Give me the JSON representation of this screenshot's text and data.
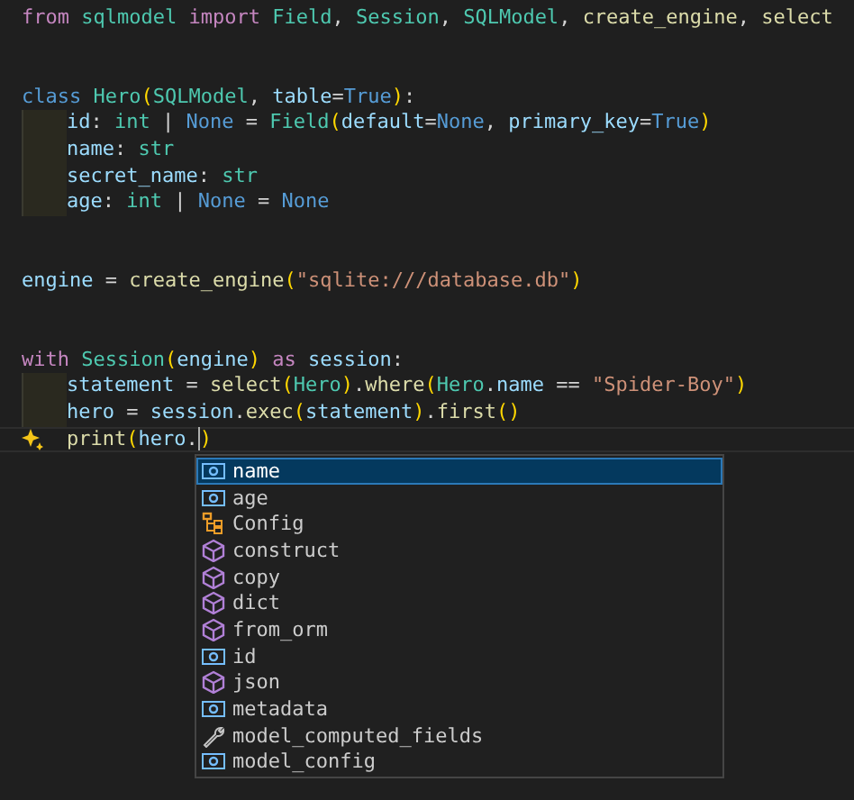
{
  "editor": {
    "lines": [
      {
        "kind": "code",
        "tokens": [
          {
            "kind": "kw",
            "text": "from "
          },
          {
            "kind": "type",
            "text": "sqlmodel "
          },
          {
            "kind": "kw",
            "text": "import "
          },
          {
            "kind": "type",
            "text": "Field"
          },
          {
            "kind": "plain",
            "text": ", "
          },
          {
            "kind": "type",
            "text": "Session"
          },
          {
            "kind": "plain",
            "text": ", "
          },
          {
            "kind": "type",
            "text": "SQLModel"
          },
          {
            "kind": "plain",
            "text": ", "
          },
          {
            "kind": "func",
            "text": "create_engine"
          },
          {
            "kind": "plain",
            "text": ", "
          },
          {
            "kind": "func",
            "text": "select"
          }
        ]
      },
      {
        "kind": "blank"
      },
      {
        "kind": "blank"
      },
      {
        "kind": "code",
        "tokens": [
          {
            "kind": "storage",
            "text": "class "
          },
          {
            "kind": "type",
            "text": "Hero"
          },
          {
            "kind": "bracket",
            "text": "("
          },
          {
            "kind": "type",
            "text": "SQLModel"
          },
          {
            "kind": "plain",
            "text": ", "
          },
          {
            "kind": "var",
            "text": "table"
          },
          {
            "kind": "plain",
            "text": "="
          },
          {
            "kind": "const",
            "text": "True"
          },
          {
            "kind": "bracket",
            "text": ")"
          },
          {
            "kind": "plain",
            "text": ":"
          }
        ]
      },
      {
        "kind": "code",
        "indented": true,
        "tokens": [
          {
            "kind": "var",
            "text": "id"
          },
          {
            "kind": "plain",
            "text": ": "
          },
          {
            "kind": "type",
            "text": "int"
          },
          {
            "kind": "plain",
            "text": " | "
          },
          {
            "kind": "const",
            "text": "None"
          },
          {
            "kind": "plain",
            "text": " = "
          },
          {
            "kind": "type",
            "text": "Field"
          },
          {
            "kind": "bracket",
            "text": "("
          },
          {
            "kind": "var",
            "text": "default"
          },
          {
            "kind": "plain",
            "text": "="
          },
          {
            "kind": "const",
            "text": "None"
          },
          {
            "kind": "plain",
            "text": ", "
          },
          {
            "kind": "var",
            "text": "primary_key"
          },
          {
            "kind": "plain",
            "text": "="
          },
          {
            "kind": "const",
            "text": "True"
          },
          {
            "kind": "bracket",
            "text": ")"
          }
        ]
      },
      {
        "kind": "code",
        "indented": true,
        "tokens": [
          {
            "kind": "var",
            "text": "name"
          },
          {
            "kind": "plain",
            "text": ": "
          },
          {
            "kind": "type",
            "text": "str"
          }
        ]
      },
      {
        "kind": "code",
        "indented": true,
        "tokens": [
          {
            "kind": "var",
            "text": "secret_name"
          },
          {
            "kind": "plain",
            "text": ": "
          },
          {
            "kind": "type",
            "text": "str"
          }
        ]
      },
      {
        "kind": "code",
        "indented": true,
        "tokens": [
          {
            "kind": "var",
            "text": "age"
          },
          {
            "kind": "plain",
            "text": ": "
          },
          {
            "kind": "type",
            "text": "int"
          },
          {
            "kind": "plain",
            "text": " | "
          },
          {
            "kind": "const",
            "text": "None"
          },
          {
            "kind": "plain",
            "text": " = "
          },
          {
            "kind": "const",
            "text": "None"
          }
        ]
      },
      {
        "kind": "blank"
      },
      {
        "kind": "blank"
      },
      {
        "kind": "code",
        "tokens": [
          {
            "kind": "var",
            "text": "engine"
          },
          {
            "kind": "plain",
            "text": " = "
          },
          {
            "kind": "func",
            "text": "create_engine"
          },
          {
            "kind": "bracket",
            "text": "("
          },
          {
            "kind": "str",
            "text": "\"sqlite:///database.db\""
          },
          {
            "kind": "bracket",
            "text": ")"
          }
        ]
      },
      {
        "kind": "blank"
      },
      {
        "kind": "blank"
      },
      {
        "kind": "code",
        "tokens": [
          {
            "kind": "kw",
            "text": "with "
          },
          {
            "kind": "type",
            "text": "Session"
          },
          {
            "kind": "bracket",
            "text": "("
          },
          {
            "kind": "var",
            "text": "engine"
          },
          {
            "kind": "bracket",
            "text": ")"
          },
          {
            "kind": "kw",
            "text": " as "
          },
          {
            "kind": "var",
            "text": "session"
          },
          {
            "kind": "plain",
            "text": ":"
          }
        ]
      },
      {
        "kind": "code",
        "indented": true,
        "tokens": [
          {
            "kind": "var",
            "text": "statement"
          },
          {
            "kind": "plain",
            "text": " = "
          },
          {
            "kind": "func",
            "text": "select"
          },
          {
            "kind": "bracket",
            "text": "("
          },
          {
            "kind": "type",
            "text": "Hero"
          },
          {
            "kind": "bracket",
            "text": ")"
          },
          {
            "kind": "plain",
            "text": "."
          },
          {
            "kind": "func",
            "text": "where"
          },
          {
            "kind": "bracket",
            "text": "("
          },
          {
            "kind": "type",
            "text": "Hero"
          },
          {
            "kind": "plain",
            "text": "."
          },
          {
            "kind": "var",
            "text": "name"
          },
          {
            "kind": "plain",
            "text": " == "
          },
          {
            "kind": "str",
            "text": "\"Spider-Boy\""
          },
          {
            "kind": "bracket",
            "text": ")"
          }
        ]
      },
      {
        "kind": "code",
        "indented": true,
        "tokens": [
          {
            "kind": "var",
            "text": "hero"
          },
          {
            "kind": "plain",
            "text": " = "
          },
          {
            "kind": "var",
            "text": "session"
          },
          {
            "kind": "plain",
            "text": "."
          },
          {
            "kind": "func",
            "text": "exec"
          },
          {
            "kind": "bracket",
            "text": "("
          },
          {
            "kind": "var",
            "text": "statement"
          },
          {
            "kind": "bracket",
            "text": ")"
          },
          {
            "kind": "plain",
            "text": "."
          },
          {
            "kind": "func",
            "text": "first"
          },
          {
            "kind": "bracket",
            "text": "()"
          }
        ]
      },
      {
        "kind": "code",
        "indented": true,
        "current": true,
        "ai_hint": true,
        "caret": true,
        "tokens": [
          {
            "kind": "func",
            "text": "print"
          },
          {
            "kind": "bracket",
            "text": "("
          },
          {
            "kind": "var",
            "text": "hero"
          },
          {
            "kind": "plain",
            "text": "."
          },
          {
            "kind": "bracket",
            "text": ")"
          }
        ]
      }
    ]
  },
  "suggestions": [
    {
      "label": "name",
      "kind": "field",
      "selected": true
    },
    {
      "label": "age",
      "kind": "field",
      "selected": false
    },
    {
      "label": "Config",
      "kind": "class",
      "selected": false
    },
    {
      "label": "construct",
      "kind": "method",
      "selected": false
    },
    {
      "label": "copy",
      "kind": "method",
      "selected": false
    },
    {
      "label": "dict",
      "kind": "method",
      "selected": false
    },
    {
      "label": "from_orm",
      "kind": "method",
      "selected": false
    },
    {
      "label": "id",
      "kind": "field",
      "selected": false
    },
    {
      "label": "json",
      "kind": "method",
      "selected": false
    },
    {
      "label": "metadata",
      "kind": "field",
      "selected": false
    },
    {
      "label": "model_computed_fields",
      "kind": "property",
      "selected": false
    },
    {
      "label": "model_config",
      "kind": "field",
      "selected": false
    }
  ]
}
